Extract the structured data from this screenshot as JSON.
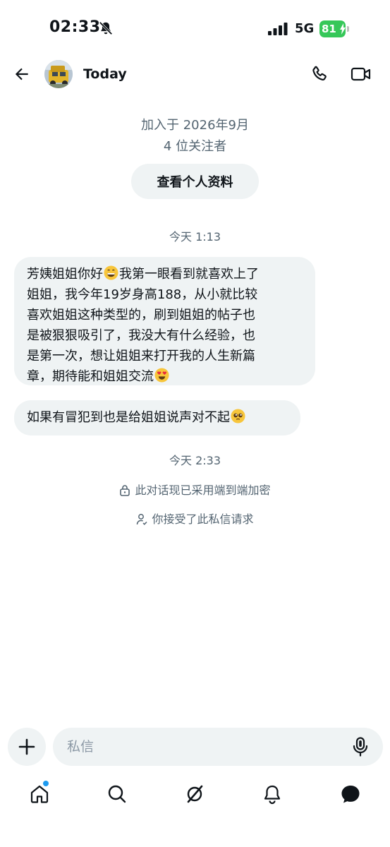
{
  "status_bar": {
    "time": "02:33",
    "network": "5G",
    "battery": "81"
  },
  "header": {
    "title": "Today"
  },
  "profile": {
    "joined": "加入于 2026年9月",
    "followers": "4 位关注者",
    "view_profile_label": "查看个人资料"
  },
  "messages": {
    "timestamp_1": "今天 1:13",
    "bubble_1": {
      "line_1_a": "芳姨姐姐你好",
      "line_1_b": "我第一眼看到就喜欢上了",
      "line_2": "姐姐，我今年19岁身高188，从小就比较",
      "line_3": "喜欢姐姐这种类型的，刷到姐姐的帖子也",
      "line_4": "是被狠狠吸引了，我没大有什么经验，也",
      "line_5": "是第一次，想让姐姐来打开我的人生新篇",
      "line_6": "章，期待能和姐姐交流"
    },
    "bubble_2": "如果有冒犯到也是给姐姐说声对不起",
    "timestamp_2": "今天 2:33",
    "encrypted_notice": "此对话现已采用端到端加密",
    "accepted_notice": "你接受了此私信请求"
  },
  "composer": {
    "placeholder": "私信"
  },
  "icons": {
    "back": "back-arrow-icon",
    "phone": "phone-icon",
    "video": "video-camera-icon",
    "plus": "plus-icon",
    "mic": "microphone-icon",
    "home": "home-icon",
    "search": "search-icon",
    "grok": "grok-icon",
    "notifications": "bell-icon",
    "messages": "messages-icon"
  },
  "colors": {
    "bubble": "#eff3f4",
    "secondary_text": "#536471",
    "accent": "#1d9bf0",
    "battery": "#36c759"
  }
}
